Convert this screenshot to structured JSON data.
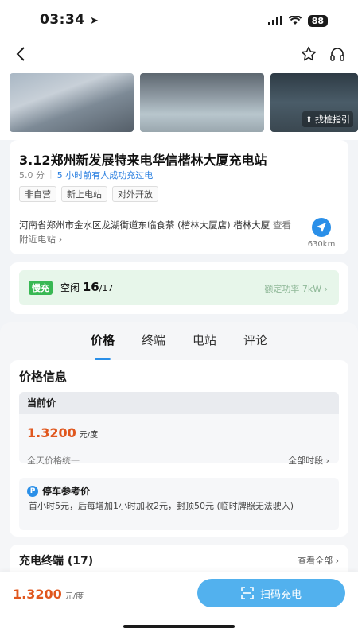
{
  "status": {
    "time": "03:34",
    "battery": "88"
  },
  "photos": {
    "guide_label": "找桩指引"
  },
  "station": {
    "title": "3.12郑州新发展特来电华信楷林大厦充电站",
    "rating": "5.0 分",
    "recent": "5 小时前有人成功充过电",
    "tags": [
      "非自营",
      "新上电站",
      "对外开放"
    ],
    "address": "河南省郑州市金水区龙湖街道东临食茶 (楷林大厦店) 楷林大厦",
    "nearby": "查看附近电站",
    "distance": "630km"
  },
  "charger": {
    "type": "慢充",
    "idle_label": "空闲",
    "idle_count": "16",
    "total": "/17",
    "power": "额定功率 7kW"
  },
  "tabs": [
    "价格",
    "终端",
    "电站",
    "评论"
  ],
  "price": {
    "section_title": "价格信息",
    "current_label": "当前价",
    "value": "1.3200",
    "unit": "元/度",
    "uniform": "全天价格统一",
    "all_periods": "全部时段"
  },
  "parking": {
    "title": "停车参考价",
    "text": "首小时5元，后每增加1小时加收2元，封顶50元 (临时牌照无法驶入)"
  },
  "terminals": {
    "title": "充电终端 (17)",
    "view_all": "查看全部"
  },
  "bottom": {
    "price": "1.3200",
    "unit": "元/度",
    "scan_label": "扫码充电"
  },
  "colors": {
    "accent": "#2a8fe8",
    "price": "#e0571e",
    "slow_badge": "#39b854"
  }
}
